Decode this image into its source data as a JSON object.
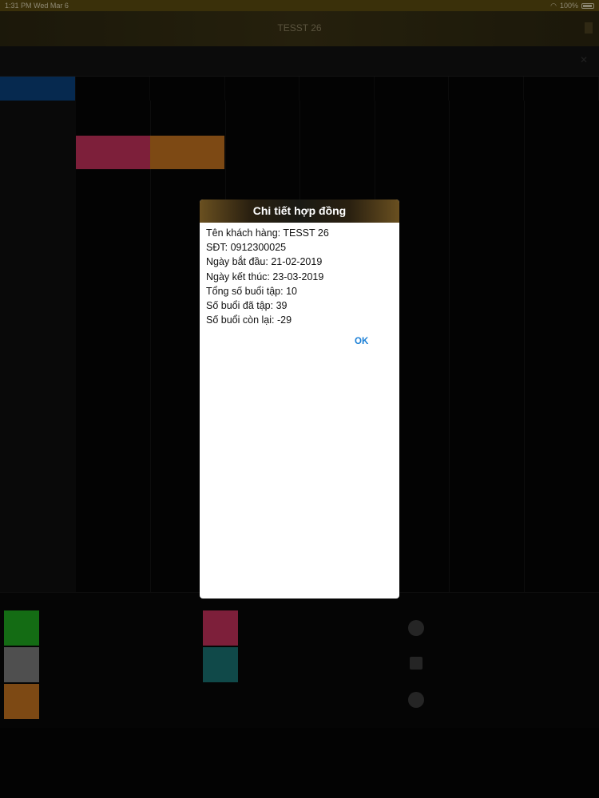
{
  "status_bar": {
    "time": "1:31 PM",
    "date": "Wed Mar 6",
    "battery": "100%"
  },
  "nav": {
    "title": "TESST 26"
  },
  "dialog": {
    "title": "Chi tiết hợp đồng",
    "lines": [
      {
        "label": "Tên khách hàng:",
        "value": "TESST 26"
      },
      {
        "label": "SĐT:",
        "value": "0912300025"
      },
      {
        "label": "Ngày bắt đầu:",
        "value": "21-02-2019"
      },
      {
        "label": "Ngày kết thúc:",
        "value": "23-03-2019"
      },
      {
        "label": "Tổng số buổi tập:",
        "value": "10"
      },
      {
        "label": "Số buổi đã tập:",
        "value": "39"
      },
      {
        "label": "Số buổi còn lại:",
        "value": "-29"
      }
    ],
    "ok_label": "OK"
  },
  "colors": {
    "accent_blue": "#1a7fd6",
    "header_gold": "#6a5020",
    "booking_pink": "#c0305a",
    "booking_orange": "#c07020",
    "legend_green": "#1fa71f",
    "legend_gray": "#7a7a7a",
    "legend_orange": "#c07020",
    "legend_pink": "#c0305a",
    "legend_teal": "#1a7070"
  }
}
